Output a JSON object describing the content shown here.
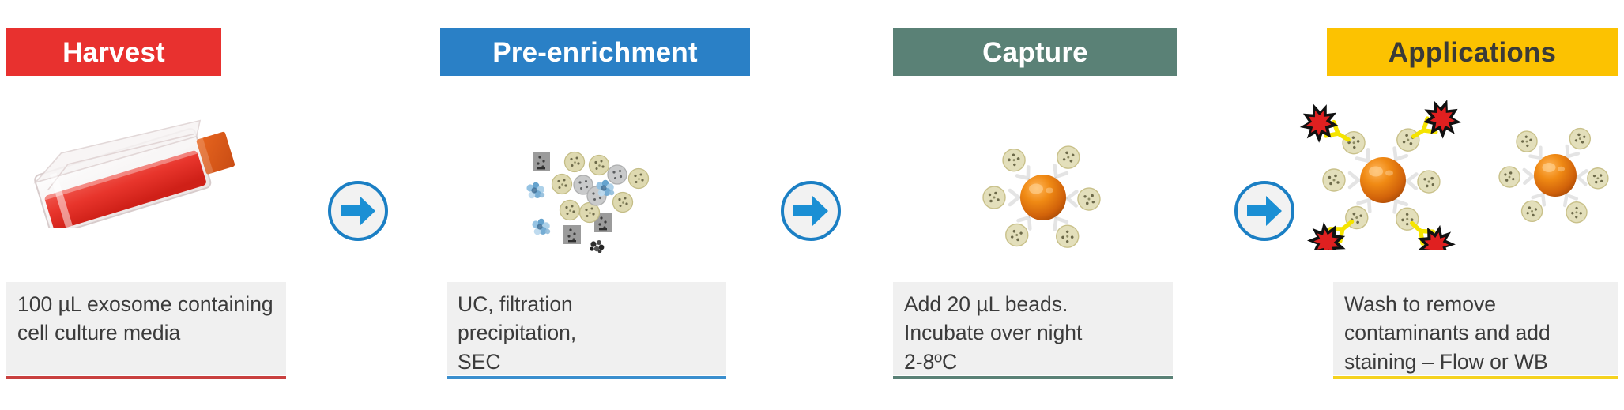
{
  "diagram": {
    "title": "Exosome capture workflow",
    "type": "process-flow",
    "stage_count": 4,
    "arrow_count": 3
  },
  "stages": [
    {
      "id": "harvest",
      "header": "Harvest",
      "header_bg": "#e8312f",
      "header_text_color": "#ffffff",
      "rule_color": "#c9403f",
      "caption": "100 µL exosome containing cell culture media",
      "artwork": "culture-flask-red-media"
    },
    {
      "id": "pre-enrichment",
      "header": "Pre-enrichment",
      "header_bg": "#2a80c6",
      "header_text_color": "#ffffff",
      "rule_color": "#3b8fce",
      "caption": "UC, filtration\nprecipitation,\nSEC",
      "artwork": "mixed-vesicle-contaminant-cluster"
    },
    {
      "id": "capture",
      "header": "Capture",
      "header_bg": "#5a8176",
      "header_text_color": "#ffffff",
      "rule_color": "#5a8176",
      "caption": "Add 20 µL beads.\nIncubate over night\n2-8ºC",
      "artwork": "bead-antibody-vesicle-complex"
    },
    {
      "id": "applications",
      "header": "Applications",
      "header_bg": "#fcc201",
      "header_text_color": "#3a3a38",
      "rule_color": "#f5d21f",
      "caption": "Wash to remove\ncontaminants and add\nstaining – Flow or WB",
      "artwork": "stained-bead-complex-pair"
    }
  ],
  "arrows": [
    {
      "id": "arrow-harvest-to-preenrichment",
      "direction": "right",
      "icon": "arrow-right-circle-icon"
    },
    {
      "id": "arrow-preenrichment-to-capture",
      "direction": "right",
      "icon": "arrow-right-circle-icon"
    },
    {
      "id": "arrow-capture-to-applications",
      "direction": "right",
      "icon": "arrow-right-circle-icon"
    }
  ],
  "palette": {
    "arrow_fill": "#1b8fd4",
    "arrow_ring": "#1b7fc4",
    "arrow_disc": "#f2f2f2",
    "caption_bg": "#f0f0f0",
    "caption_text": "#3b3b3b",
    "bead_orange": "#e2700f",
    "vesicle_tan": "#ded9b0",
    "vesicle_gray": "#c9cacb",
    "contaminant_blue": "#7fb3d8",
    "aggregate_gray": "#9b9b9b",
    "fluorophore_red": "#e02020",
    "fluorophore_outline": "#111111",
    "stain_yellow": "#f5e400",
    "media_red": "#e8352c",
    "flask_cap": "#d9551b",
    "antibody_white": "#fbfbfb",
    "antibody_outline": "#b9b9b9"
  }
}
